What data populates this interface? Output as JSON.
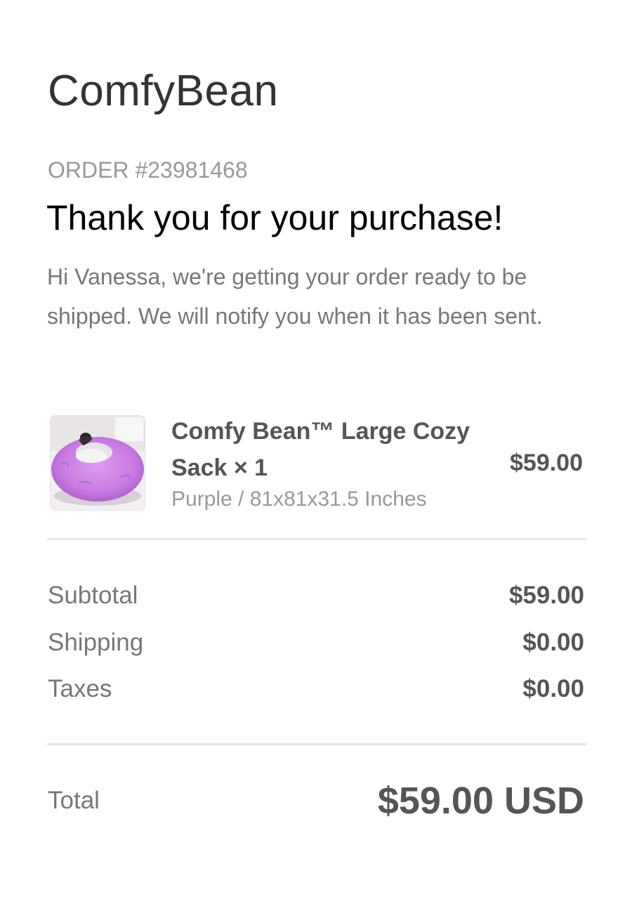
{
  "brand": {
    "name": "ComfyBean"
  },
  "order": {
    "number_label": "ORDER #23981468",
    "heading": "Thank you for your purchase!",
    "message": "Hi Vanessa, we're getting your order ready to be shipped. We will notify you when it has been sent."
  },
  "line_items": [
    {
      "title": "Comfy Bean™ Large Cozy Sack × 1",
      "variant": "Purple / 81x81x31.5 Inches",
      "price": "$59.00",
      "image_icon": "purple-bean-bag-product-photo"
    }
  ],
  "summary": {
    "subtotal_label": "Subtotal",
    "subtotal_value": "$59.00",
    "shipping_label": "Shipping",
    "shipping_value": "$0.00",
    "taxes_label": "Taxes",
    "taxes_value": "$0.00"
  },
  "total": {
    "label": "Total",
    "value": "$59.00 USD"
  },
  "colors": {
    "background": "#ffffff",
    "brand_text": "#333333",
    "heading_text": "#000000",
    "muted_text": "#999999",
    "body_text": "#777777",
    "value_text": "#555555",
    "divider": "#e6e6e6",
    "product_purple": "#c77ee0"
  }
}
